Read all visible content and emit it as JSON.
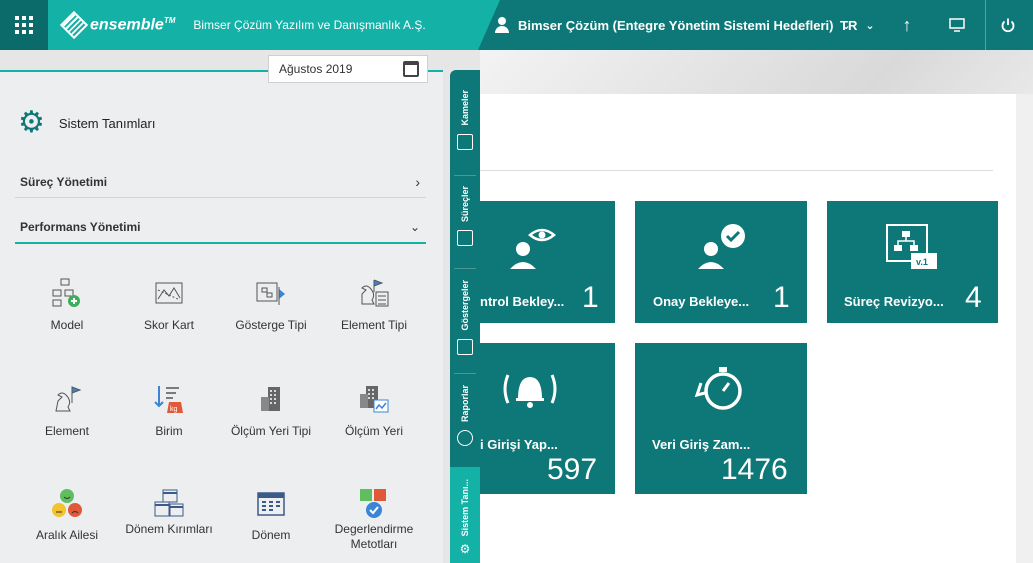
{
  "topbar": {
    "brand": "ensemble",
    "trademark": "TM",
    "company": "Bimser Çözüm Yazılım ve Danışmanlık A.Ş.",
    "user": "Bimser Çözüm (Entegre Yönetim Sistemi Hedefleri)",
    "language": "TR"
  },
  "date_picker": {
    "value": "Ağustos 2019"
  },
  "panel": {
    "title": "Sistem Tanımları",
    "sections": [
      {
        "label": "Süreç Yönetimi"
      },
      {
        "label": "Performans Yönetimi"
      }
    ],
    "items": [
      {
        "label": "Model",
        "icon": "model-icon"
      },
      {
        "label": "Skor Kart",
        "icon": "scorecard-icon"
      },
      {
        "label": "Gösterge Tipi",
        "icon": "indicator-type-icon"
      },
      {
        "label": "Element Tipi",
        "icon": "element-type-icon"
      },
      {
        "label": "Element",
        "icon": "element-icon"
      },
      {
        "label": "Birim",
        "icon": "unit-icon"
      },
      {
        "label": "Ölçüm Yeri Tipi",
        "icon": "measure-place-type-icon"
      },
      {
        "label": "Ölçüm Yeri",
        "icon": "measure-place-icon"
      },
      {
        "label": "Aralık Ailesi",
        "icon": "range-family-icon"
      },
      {
        "label": "Dönem Kırımları",
        "icon": "period-breaks-icon"
      },
      {
        "label": "Dönem",
        "icon": "period-icon"
      },
      {
        "label": "Degerlendirme Metotları",
        "icon": "evaluation-methods-icon"
      }
    ]
  },
  "vtabs": [
    {
      "label": "Kameler"
    },
    {
      "label": "Süreçler"
    },
    {
      "label": "Göstergeler"
    },
    {
      "label": "Raporlar"
    },
    {
      "label": "Sistem Tanı..."
    }
  ],
  "tiles": [
    {
      "label": "ntrol Bekley...",
      "value": "1"
    },
    {
      "label": "Onay Bekleye...",
      "value": "1"
    },
    {
      "label": "Süreç Revizyo...",
      "value": "4"
    },
    {
      "label": "i Girişi Yap...",
      "value": "597"
    },
    {
      "label": "Veri Giriş Zam...",
      "value": "1476"
    }
  ],
  "colors": {
    "primary": "#0e7777",
    "accent": "#14b1a7",
    "panel": "#eceef0"
  }
}
